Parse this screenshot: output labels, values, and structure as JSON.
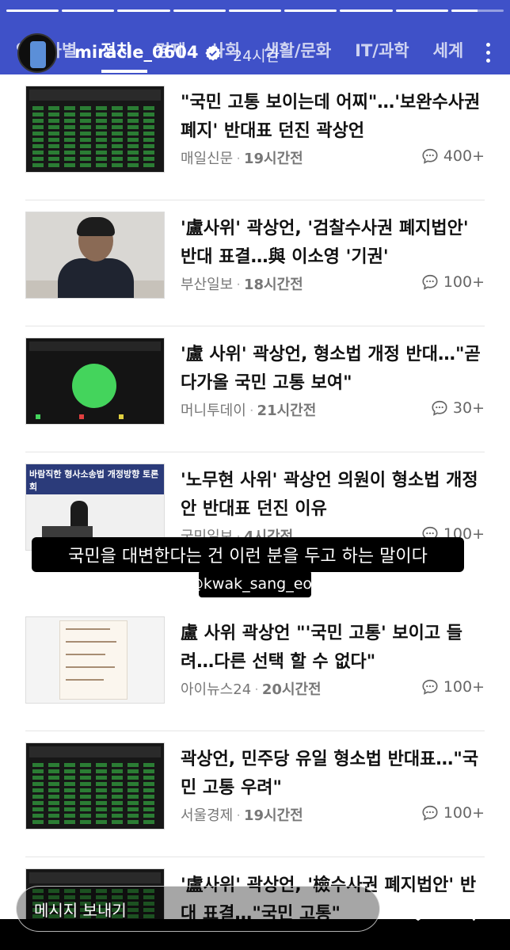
{
  "story": {
    "progress_segments": [
      1.0,
      1.0,
      1.0,
      1.0,
      1.0,
      1.0,
      1.0,
      1.0,
      0.5
    ],
    "username": "miracle_0604",
    "verified": true,
    "time": "24시간",
    "caption": "국민을 대변한다는 건 이런 분을 두고 하는 말이다",
    "mention": "@kwak_sang_eon",
    "message_placeholder": "메시지 보내기"
  },
  "news": {
    "categories": [
      {
        "label": "연예사별",
        "active": false
      },
      {
        "label": "정치",
        "active": true
      },
      {
        "label": "경제",
        "active": false
      },
      {
        "label": "사회",
        "active": false
      },
      {
        "label": "생활/문화",
        "active": false
      },
      {
        "label": "IT/과학",
        "active": false
      },
      {
        "label": "세계",
        "active": false
      }
    ],
    "articles": [
      {
        "title": "\"국민 고통 보이는데 어찌\"…'보완수사권 폐지' 반대표 던진 곽상언",
        "source": "매일신문",
        "time": "19시간전",
        "comments": "400+",
        "thumb": "vote"
      },
      {
        "title": "'盧사위' 곽상언, '검찰수사권 폐지법안' 반대 표결…與 이소영 '기권'",
        "source": "부산일보",
        "time": "18시간전",
        "comments": "100+",
        "thumb": "person"
      },
      {
        "title": "'盧 사위' 곽상언, 형소법 개정 반대…\"곧 다가올 국민 고통 보여\"",
        "source": "머니투데이",
        "time": "21시간전",
        "comments": "30+",
        "thumb": "pie"
      },
      {
        "title": "'노무현 사위' 곽상언 의원이 형소법 개정안 반대표 던진 이유",
        "source": "국민일보",
        "time": "4시간전",
        "comments": "100+",
        "thumb": "forum",
        "banner": "바람직한 형사소송법 개정방향 토론회"
      },
      {
        "title": "盧 사위 곽상언 \"'국민 고통' 보이고 들려…다른 선택 할 수 없다\"",
        "source": "아이뉴스24",
        "time": "20시간전",
        "comments": "100+",
        "thumb": "note"
      },
      {
        "title": "곽상언, 민주당 유일 형소법 반대표…\"국민 고통 우려\"",
        "source": "서울경제",
        "time": "19시간전",
        "comments": "100+",
        "thumb": "vote"
      },
      {
        "title": "'盧사위' 곽상언, '檢수사권 폐지법안' 반대 표결…\"국민 고통\"",
        "source": "",
        "time": "",
        "comments": "",
        "thumb": "vote"
      }
    ]
  },
  "colors": {
    "header_blue": "#3f51c8",
    "green_vote": "#2f8f3a"
  }
}
